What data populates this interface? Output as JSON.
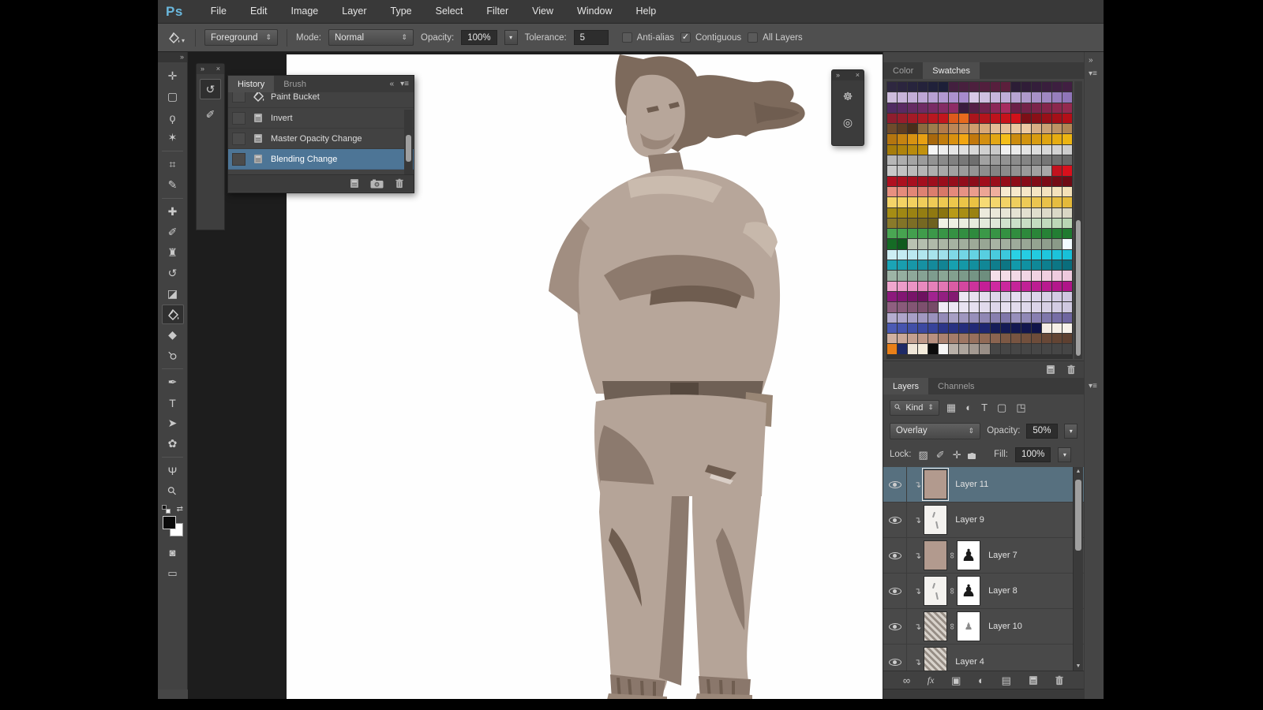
{
  "app": {
    "logo": "Ps",
    "menus": [
      "File",
      "Edit",
      "Image",
      "Layer",
      "Type",
      "Select",
      "Filter",
      "View",
      "Window",
      "Help"
    ]
  },
  "options_bar": {
    "tool_icon": "paint-bucket",
    "fill_source": "Foreground",
    "mode_label": "Mode:",
    "mode": "Normal",
    "opacity_label": "Opacity:",
    "opacity": "100%",
    "tolerance_label": "Tolerance:",
    "tolerance": "5",
    "checkboxes": [
      {
        "label": "Anti-alias",
        "checked": false
      },
      {
        "label": "Contiguous",
        "checked": true
      },
      {
        "label": "All Layers",
        "checked": false
      }
    ]
  },
  "toolbar": {
    "collapse_icon": "»",
    "tools": [
      {
        "name": "move-tool",
        "glyph": "✛"
      },
      {
        "name": "rectangular-marquee-tool",
        "glyph": "▢"
      },
      {
        "name": "lasso-tool",
        "glyph": "ϙ"
      },
      {
        "name": "magic-wand-tool",
        "glyph": "✶"
      },
      {
        "sep": true
      },
      {
        "name": "crop-tool",
        "glyph": "⌗"
      },
      {
        "name": "eyedropper-tool",
        "glyph": "✎"
      },
      {
        "sep": true
      },
      {
        "name": "spot-healing-brush-tool",
        "glyph": "✚"
      },
      {
        "name": "brush-tool",
        "glyph": "✐"
      },
      {
        "name": "clone-stamp-tool",
        "glyph": "♜"
      },
      {
        "name": "history-brush-tool",
        "glyph": "↺"
      },
      {
        "name": "eraser-tool",
        "glyph": "◪"
      },
      {
        "name": "paint-bucket-tool",
        "glyph": "@bucket",
        "active": true
      },
      {
        "name": "blur-tool",
        "glyph": "◆"
      },
      {
        "name": "dodge-tool",
        "glyph": "⚲"
      },
      {
        "sep": true
      },
      {
        "name": "pen-tool",
        "glyph": "✒"
      },
      {
        "name": "type-tool",
        "glyph": "T"
      },
      {
        "name": "path-selection-tool",
        "glyph": "➤"
      },
      {
        "name": "custom-shape-tool",
        "glyph": "✿"
      },
      {
        "sep": true
      },
      {
        "name": "hand-tool",
        "glyph": "Ψ"
      },
      {
        "name": "zoom-tool",
        "glyph": "⚲"
      }
    ],
    "foreground_color": "#0a0a0a",
    "background_color": "#ffffff",
    "quick_mask_icon": "◙",
    "screen_mode_icon": "▭",
    "swap_colors_icon": "⇄"
  },
  "history_panel": {
    "dock_collapse_icon": "»",
    "close_icon": "×",
    "dock_icons": [
      {
        "name": "history-panel-icon",
        "glyph": "↺"
      },
      {
        "name": "brush-panel-icon",
        "glyph": "✐"
      }
    ],
    "tabs": [
      {
        "label": "History",
        "active": true
      },
      {
        "label": "Brush",
        "active": false
      }
    ],
    "collapse_icon": "«",
    "menu_icon": "▾≡",
    "items": [
      {
        "label": "Paint Bucket",
        "icon": "@bucket",
        "cut": true
      },
      {
        "label": "Invert",
        "icon": "@doc"
      },
      {
        "label": "Master Opacity Change",
        "icon": "@doc"
      },
      {
        "label": "Blending Change",
        "icon": "@doc",
        "selected": true
      }
    ],
    "footer_icons": [
      {
        "name": "new-document-from-state-icon",
        "glyph": "@doc"
      },
      {
        "name": "new-snapshot-icon",
        "glyph": "@camera"
      },
      {
        "name": "delete-state-icon",
        "glyph": "@trash"
      }
    ]
  },
  "float_panel": {
    "collapse_icon": "»",
    "close_icon": "×",
    "icons": [
      {
        "name": "adjustments-panel-icon",
        "glyph": "☸"
      },
      {
        "name": "clone-source-panel-icon",
        "glyph": "◎"
      }
    ]
  },
  "swatches_panel": {
    "tabs": [
      {
        "label": "Color",
        "active": false
      },
      {
        "label": "Swatches",
        "active": true
      }
    ],
    "footer_icons": [
      {
        "name": "new-swatch-icon",
        "glyph": "@doc"
      },
      {
        "name": "delete-swatch-icon",
        "glyph": "@trash"
      }
    ],
    "grid_cols": 18,
    "rows": [
      [
        [
          "#2e2740",
          "#1d1f38",
          6
        ],
        [
          "#43203f",
          "#5c1f3c",
          6
        ],
        [
          "#2c1d36",
          "#411f42",
          6
        ]
      ],
      [
        [
          "#cdbbdc",
          "#a78bcc",
          8
        ],
        [
          "#d7c9e6",
          "#8f75b8",
          10
        ]
      ],
      [
        [
          "#502a62",
          "#8e2c66",
          7
        ],
        [
          "#3a1c3e",
          "#a62c60",
          5
        ],
        [
          "#6b2048",
          "#93294f",
          6
        ]
      ],
      [
        [
          "#8f1d2e",
          "#c3161d",
          6
        ],
        [
          "#dd5a1d",
          "#e76a1e",
          2
        ],
        [
          "#aa151d",
          "#d1111a",
          5
        ],
        [
          "#7c0f17",
          "#b30f18",
          5
        ]
      ],
      [
        [
          "#6f4b2b",
          "#4a2e1a",
          3
        ],
        [
          "#8c6b3e",
          "#9d7c4b",
          2
        ],
        [
          "#b37b4a",
          "#d8a878",
          5
        ],
        [
          "#e3bd96",
          "#eccaa4",
          4
        ],
        [
          "#d8ae84",
          "#b08654",
          4
        ]
      ],
      [
        [
          "#b4750f",
          "#e8a012",
          4
        ],
        [
          "#a8680c",
          "#f2a612",
          4
        ],
        [
          "#c2780c",
          "#f4be1a",
          4
        ],
        [
          "#cc8c0e",
          "#ecb412",
          6
        ]
      ],
      [
        [
          "#a67c0a",
          "#c2920e",
          4
        ],
        [
          "#f5f5f5",
          "#c9c9c9",
          7
        ],
        [
          "#f0f0f0",
          "#cccccc",
          7
        ]
      ],
      [
        [
          "#b6b6b6",
          "#6f6f6f",
          9
        ],
        [
          "#a2a2a2",
          "#676767",
          9
        ]
      ],
      [
        [
          "#c8c8c8",
          "#8e8e8e",
          10
        ],
        [
          "#848484",
          "#a8a8a8",
          6
        ],
        [
          "#c2121e",
          "#d8101c",
          2
        ]
      ],
      [
        [
          "#b01020",
          "#8c0c1a",
          9
        ],
        [
          "#a00e1c",
          "#6e0a14",
          9
        ]
      ],
      [
        [
          "#e89080",
          "#d87868",
          6
        ],
        [
          "#e4897b",
          "#efae9e",
          5
        ],
        [
          "#f7ead0",
          "#f3e0b8",
          7
        ]
      ],
      [
        [
          "#f4d468",
          "#eac243",
          9
        ],
        [
          "#f6da74",
          "#e4b93a",
          9
        ]
      ],
      [
        [
          "#a68d14",
          "#8a7410",
          6
        ],
        [
          "#b89a18",
          "#9a8212",
          3
        ],
        [
          "#eceadc",
          "#d9d6c4",
          9
        ]
      ],
      [
        [
          "#8a7a2a",
          "#6f621f",
          5
        ],
        [
          "#f2f2e6",
          "#dfe8d8",
          6
        ],
        [
          "#cfe2cc",
          "#b9d6b4",
          7
        ]
      ],
      [
        [
          "#4aa653",
          "#2e8a3e",
          9
        ],
        [
          "#3b9848",
          "#1f7a30",
          9
        ]
      ],
      [
        [
          "#156b25",
          "#0f5a1e",
          2
        ],
        [
          "#b9c2b2",
          "#98a694",
          8
        ],
        [
          "#a8b4a4",
          "#8a9a88",
          7
        ],
        [
          "#f2fbff",
          "#f2fbff",
          1
        ]
      ],
      [
        [
          "#cdeef4",
          "#9fe0ea",
          6
        ],
        [
          "#7fd8e6",
          "#3cc8dc",
          6
        ],
        [
          "#2ad0e4",
          "#18c0d8",
          6
        ]
      ],
      [
        [
          "#1ba4b6",
          "#128494",
          6
        ],
        [
          "#17a0b0",
          "#0d7684",
          6
        ],
        [
          "#129aab",
          "#0a6d7c",
          6
        ]
      ],
      [
        [
          "#9db4a6",
          "#7e9c8e",
          5
        ],
        [
          "#8aa695",
          "#6e8e7e",
          5
        ],
        [
          "#f4dfe9",
          "#eec9dd",
          8
        ]
      ],
      [
        [
          "#f0a6ce",
          "#e276b4",
          6
        ],
        [
          "#da5ca4",
          "#c41e96",
          4
        ],
        [
          "#ce2aa0",
          "#b01488",
          8
        ]
      ],
      [
        [
          "#8c1a7c",
          "#6e1260",
          4
        ],
        [
          "#a12490",
          "#841a72",
          3
        ],
        [
          "#ece6f2",
          "#d9d2e6",
          5
        ],
        [
          "#e4def0",
          "#cfc6e0",
          6
        ]
      ],
      [
        [
          "#8f5f80",
          "#774a68",
          5
        ],
        [
          "#f0ecf6",
          "#ddd6ea",
          6
        ],
        [
          "#e6e0f0",
          "#cfc8e0",
          7
        ]
      ],
      [
        [
          "#b4accf",
          "#948bb8",
          6
        ],
        [
          "#a79fc4",
          "#8077aa",
          6
        ],
        [
          "#9890bc",
          "#6f66a0",
          6
        ]
      ],
      [
        [
          "#4b5ab4",
          "#37439a",
          5
        ],
        [
          "#2c3688",
          "#1e2670",
          5
        ],
        [
          "#161c58",
          "#10144a",
          5
        ],
        [
          "#f4ece4",
          "#f8f2ea",
          3
        ]
      ],
      [
        [
          "#d0b0a0",
          "#b89080",
          5
        ],
        [
          "#ab8270",
          "#8a6450",
          6
        ],
        [
          "#7c5844",
          "#5e4030",
          7
        ]
      ],
      [
        [
          "#e87f18",
          "#e87f18",
          1
        ],
        [
          "#1e2a66",
          "#1e2a66",
          1
        ],
        [
          "#efe6d8",
          "#f4ecdc",
          2
        ],
        [
          "#0c0c0c",
          "#0c0c0c",
          1
        ],
        [
          "#f6f6f6",
          "#f6f6f6",
          1
        ],
        [
          "#b8b0a8",
          "#988e86",
          4
        ],
        [
          "#464646",
          "#464646",
          8
        ]
      ]
    ]
  },
  "layers_panel": {
    "tabs": [
      {
        "label": "Layers",
        "active": true
      },
      {
        "label": "Channels",
        "active": false
      }
    ],
    "menu_icon": "▾≡",
    "dock_collapse_icon": "»",
    "filter": {
      "search_icon": "⚲",
      "kind": "Kind",
      "icons": [
        {
          "name": "filter-pixel-layers-icon",
          "glyph": "▦"
        },
        {
          "name": "filter-adjustment-layers-icon",
          "glyph": "◐"
        },
        {
          "name": "filter-type-layers-icon",
          "glyph": "T"
        },
        {
          "name": "filter-shape-layers-icon",
          "glyph": "▢"
        },
        {
          "name": "filter-smart-objects-icon",
          "glyph": "◳"
        }
      ]
    },
    "blend_mode": "Overlay",
    "opacity_label": "Opacity:",
    "opacity": "50%",
    "lock_label": "Lock:",
    "lock_icons": [
      {
        "name": "lock-transparent-pixels-icon",
        "glyph": "▨"
      },
      {
        "name": "lock-paint-icon",
        "glyph": "✐"
      },
      {
        "name": "lock-position-icon",
        "glyph": "✛"
      },
      {
        "name": "lock-all-icon",
        "glyph": "@lock"
      }
    ],
    "fill_label": "Fill:",
    "fill": "100%",
    "layers": [
      {
        "name": "Layer 11",
        "selected": true,
        "eye": true,
        "clipped": true,
        "thumb": "tan"
      },
      {
        "name": "Layer 9",
        "eye": true,
        "clipped": true,
        "thumb": "sketch"
      },
      {
        "name": "Layer 7",
        "eye": true,
        "clipped": true,
        "thumb": "tan",
        "linked": true,
        "mask": "figure"
      },
      {
        "name": "Layer 8",
        "eye": true,
        "clipped": true,
        "thumb": "sketch",
        "linked": true,
        "mask": "figure"
      },
      {
        "name": "Layer 10",
        "eye": true,
        "clipped": true,
        "thumb": "texture",
        "linked": true,
        "mask": "sketch-figure"
      },
      {
        "name": "Layer 4",
        "eye": true,
        "clipped": true,
        "thumb": "texture"
      }
    ],
    "footer_icons": [
      {
        "name": "link-layers-icon",
        "glyph": "∞"
      },
      {
        "name": "layer-effects-icon",
        "glyph": "fx"
      },
      {
        "name": "layer-mask-icon",
        "glyph": "▣"
      },
      {
        "name": "adjustment-layer-icon",
        "glyph": "◐"
      },
      {
        "name": "layer-group-icon",
        "glyph": "▤"
      },
      {
        "name": "new-layer-icon",
        "glyph": "@doc"
      },
      {
        "name": "delete-layer-icon",
        "glyph": "@trash"
      }
    ]
  },
  "canvas": {
    "background": "#ffffff",
    "art_palette": {
      "base": "#b7a69a",
      "shadow": "#8d7a6d",
      "dark": "#6f5d50",
      "hair": "#7d6a5c",
      "light": "#cabbae"
    }
  },
  "colors": {
    "selection_blue": "#4d7596",
    "layer_selected": "#57707f",
    "panel_bg": "#464646",
    "menubar_bg": "#393939",
    "pasteboard": "#1d1d1d",
    "logo_blue": "#6ab8dd"
  }
}
